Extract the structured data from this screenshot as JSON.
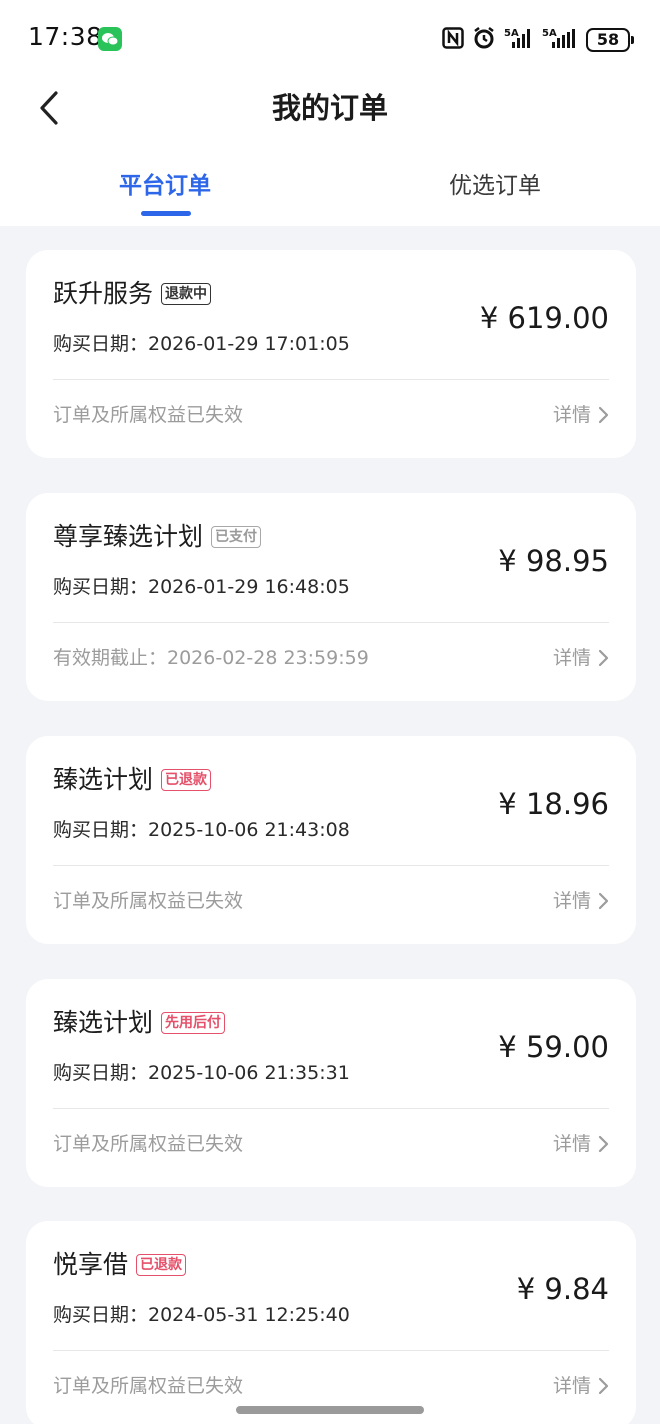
{
  "status_bar": {
    "time": "17:38",
    "battery": "58"
  },
  "header": {
    "title": "我的订单"
  },
  "tabs": [
    {
      "label": "平台订单",
      "active": true
    },
    {
      "label": "优选订单",
      "active": false
    }
  ],
  "orders": [
    {
      "name": "跃升服务",
      "badge": "退款中",
      "purchase": "购买日期：2026-01-29 17:01:05",
      "price": "¥ 619.00",
      "note": "订单及所属权益已失效",
      "detail": "详情"
    },
    {
      "name": "尊享臻选计划",
      "badge": "已支付",
      "purchase": "购买日期：2026-01-29 16:48:05",
      "price": "¥ 98.95",
      "note": "有效期截止：2026-02-28 23:59:59",
      "detail": "详情"
    },
    {
      "name": "臻选计划",
      "badge": "已退款",
      "purchase": "购买日期：2025-10-06 21:43:08",
      "price": "¥ 18.96",
      "note": "订单及所属权益已失效",
      "detail": "详情"
    },
    {
      "name": "臻选计划",
      "badge": "先用后付",
      "purchase": "购买日期：2025-10-06 21:35:31",
      "price": "¥ 59.00",
      "note": "订单及所属权益已失效",
      "detail": "详情"
    },
    {
      "name": "悦享借",
      "badge": "已退款",
      "purchase": "购买日期：2024-05-31 12:25:40",
      "price": "¥ 9.84",
      "note": "订单及所属权益已失效",
      "detail": "详情"
    }
  ],
  "colors": {
    "accent": "#2d66e8",
    "refund_red": "#e5506a"
  }
}
